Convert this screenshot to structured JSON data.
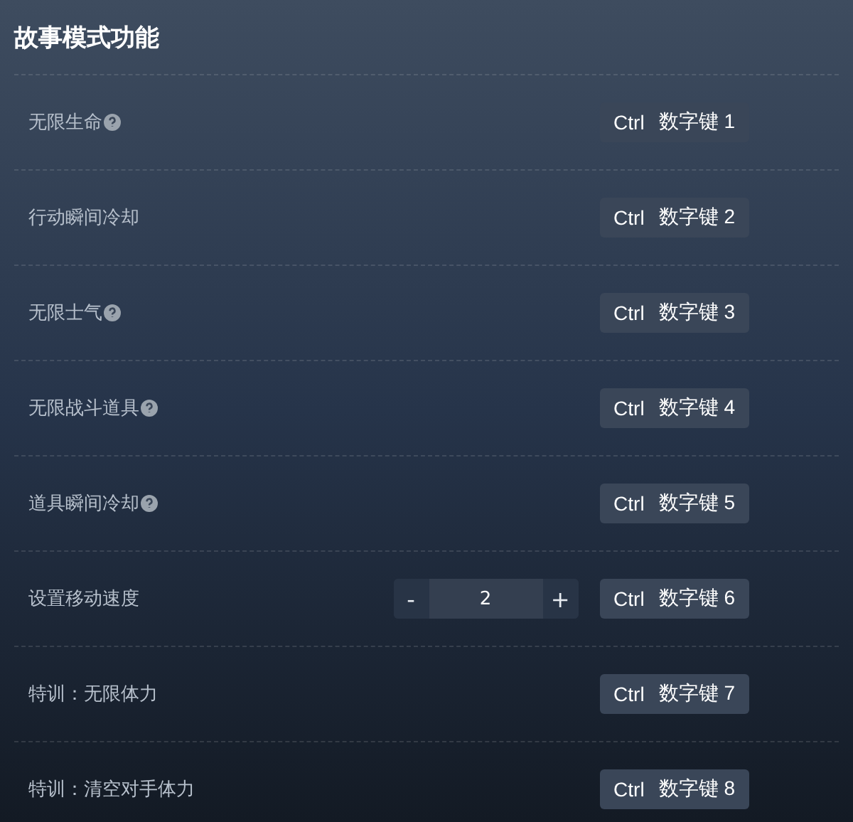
{
  "title": "故事模式功能",
  "rows": [
    {
      "kind": "toggle",
      "label": "无限生命",
      "help": true,
      "hotkey": {
        "modifier": "Ctrl",
        "key": "数字键 1"
      }
    },
    {
      "kind": "toggle",
      "label": "行动瞬间冷却",
      "help": false,
      "hotkey": {
        "modifier": "Ctrl",
        "key": "数字键 2"
      }
    },
    {
      "kind": "toggle",
      "label": "无限士气",
      "help": true,
      "hotkey": {
        "modifier": "Ctrl",
        "key": "数字键 3"
      }
    },
    {
      "kind": "toggle",
      "label": "无限战斗道具",
      "help": true,
      "hotkey": {
        "modifier": "Ctrl",
        "key": "数字键 4"
      }
    },
    {
      "kind": "toggle",
      "label": "道具瞬间冷却",
      "help": true,
      "hotkey": {
        "modifier": "Ctrl",
        "key": "数字键 5"
      }
    },
    {
      "kind": "stepper",
      "label": "设置移动速度",
      "help": false,
      "minus": "-",
      "value": "2",
      "plus": "+",
      "hotkey": {
        "modifier": "Ctrl",
        "key": "数字键 6"
      }
    },
    {
      "kind": "toggle",
      "label": "特训：无限体力",
      "help": false,
      "hotkey": {
        "modifier": "Ctrl",
        "key": "数字键 7"
      }
    },
    {
      "kind": "toggle",
      "label": "特训：清空对手体力",
      "help": false,
      "hotkey": {
        "modifier": "Ctrl",
        "key": "数字键 8"
      }
    }
  ]
}
